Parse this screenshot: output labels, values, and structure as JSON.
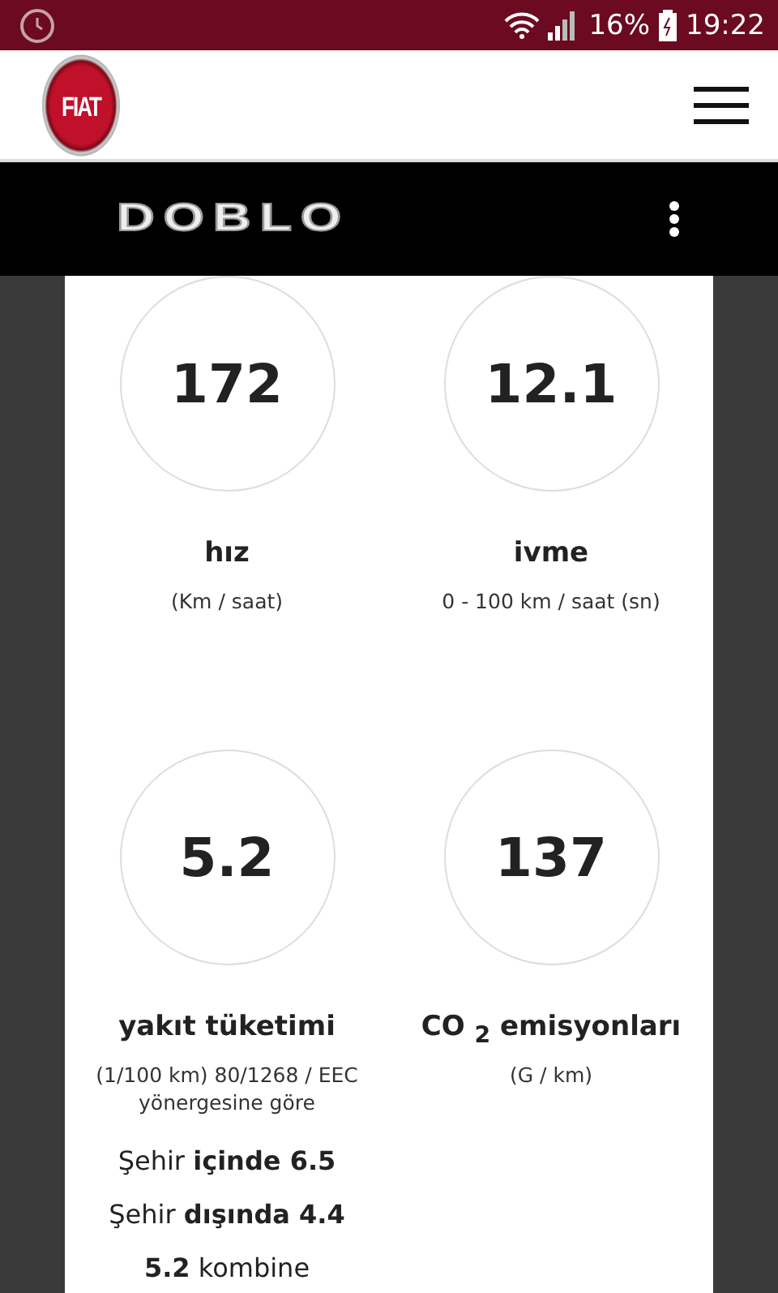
{
  "status_bar": {
    "battery": "16%",
    "time": "19:22"
  },
  "header": {
    "brand": "FIAT"
  },
  "model_bar": {
    "model": "DOBLO"
  },
  "specs": [
    {
      "value": "172",
      "label": "hız",
      "unit": "(Km / saat)"
    },
    {
      "value": "12.1",
      "label": "ivme",
      "unit": "0 - 100 km / saat (sn)"
    },
    {
      "value": "5.2",
      "label": "yakıt tüketimi",
      "unit": "(1/100 km) 80/1268 / EEC yönergesine göre",
      "details": [
        "Şehir **içinde 6.5**",
        "Şehir **dışında 4.4**",
        "**5.2** kombine"
      ]
    },
    {
      "value": "137",
      "label": "CO $_{2}$ emisyonları",
      "unit": "(G / km)"
    }
  ]
}
